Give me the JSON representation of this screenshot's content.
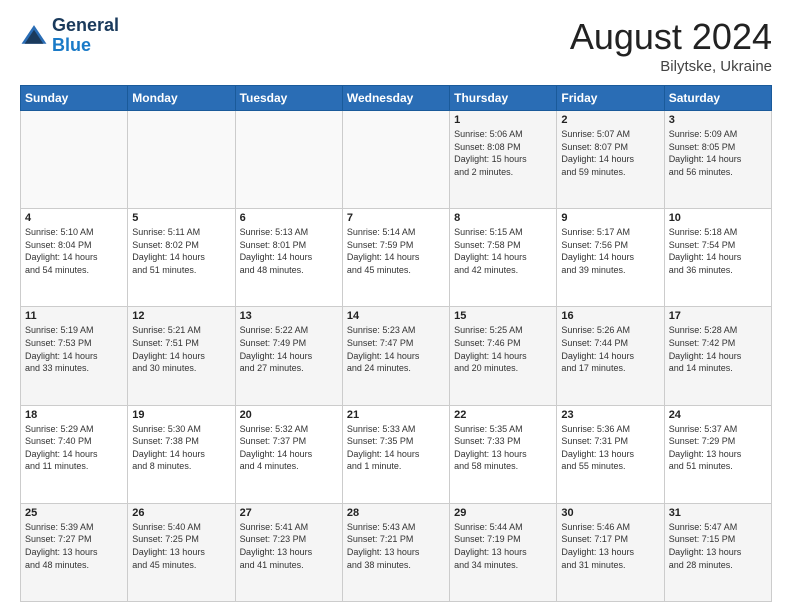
{
  "header": {
    "logo_line1": "General",
    "logo_line2": "Blue",
    "month": "August 2024",
    "location": "Bilytske, Ukraine"
  },
  "weekdays": [
    "Sunday",
    "Monday",
    "Tuesday",
    "Wednesday",
    "Thursday",
    "Friday",
    "Saturday"
  ],
  "weeks": [
    [
      {
        "day": "",
        "info": ""
      },
      {
        "day": "",
        "info": ""
      },
      {
        "day": "",
        "info": ""
      },
      {
        "day": "",
        "info": ""
      },
      {
        "day": "1",
        "info": "Sunrise: 5:06 AM\nSunset: 8:08 PM\nDaylight: 15 hours\nand 2 minutes."
      },
      {
        "day": "2",
        "info": "Sunrise: 5:07 AM\nSunset: 8:07 PM\nDaylight: 14 hours\nand 59 minutes."
      },
      {
        "day": "3",
        "info": "Sunrise: 5:09 AM\nSunset: 8:05 PM\nDaylight: 14 hours\nand 56 minutes."
      }
    ],
    [
      {
        "day": "4",
        "info": "Sunrise: 5:10 AM\nSunset: 8:04 PM\nDaylight: 14 hours\nand 54 minutes."
      },
      {
        "day": "5",
        "info": "Sunrise: 5:11 AM\nSunset: 8:02 PM\nDaylight: 14 hours\nand 51 minutes."
      },
      {
        "day": "6",
        "info": "Sunrise: 5:13 AM\nSunset: 8:01 PM\nDaylight: 14 hours\nand 48 minutes."
      },
      {
        "day": "7",
        "info": "Sunrise: 5:14 AM\nSunset: 7:59 PM\nDaylight: 14 hours\nand 45 minutes."
      },
      {
        "day": "8",
        "info": "Sunrise: 5:15 AM\nSunset: 7:58 PM\nDaylight: 14 hours\nand 42 minutes."
      },
      {
        "day": "9",
        "info": "Sunrise: 5:17 AM\nSunset: 7:56 PM\nDaylight: 14 hours\nand 39 minutes."
      },
      {
        "day": "10",
        "info": "Sunrise: 5:18 AM\nSunset: 7:54 PM\nDaylight: 14 hours\nand 36 minutes."
      }
    ],
    [
      {
        "day": "11",
        "info": "Sunrise: 5:19 AM\nSunset: 7:53 PM\nDaylight: 14 hours\nand 33 minutes."
      },
      {
        "day": "12",
        "info": "Sunrise: 5:21 AM\nSunset: 7:51 PM\nDaylight: 14 hours\nand 30 minutes."
      },
      {
        "day": "13",
        "info": "Sunrise: 5:22 AM\nSunset: 7:49 PM\nDaylight: 14 hours\nand 27 minutes."
      },
      {
        "day": "14",
        "info": "Sunrise: 5:23 AM\nSunset: 7:47 PM\nDaylight: 14 hours\nand 24 minutes."
      },
      {
        "day": "15",
        "info": "Sunrise: 5:25 AM\nSunset: 7:46 PM\nDaylight: 14 hours\nand 20 minutes."
      },
      {
        "day": "16",
        "info": "Sunrise: 5:26 AM\nSunset: 7:44 PM\nDaylight: 14 hours\nand 17 minutes."
      },
      {
        "day": "17",
        "info": "Sunrise: 5:28 AM\nSunset: 7:42 PM\nDaylight: 14 hours\nand 14 minutes."
      }
    ],
    [
      {
        "day": "18",
        "info": "Sunrise: 5:29 AM\nSunset: 7:40 PM\nDaylight: 14 hours\nand 11 minutes."
      },
      {
        "day": "19",
        "info": "Sunrise: 5:30 AM\nSunset: 7:38 PM\nDaylight: 14 hours\nand 8 minutes."
      },
      {
        "day": "20",
        "info": "Sunrise: 5:32 AM\nSunset: 7:37 PM\nDaylight: 14 hours\nand 4 minutes."
      },
      {
        "day": "21",
        "info": "Sunrise: 5:33 AM\nSunset: 7:35 PM\nDaylight: 14 hours\nand 1 minute."
      },
      {
        "day": "22",
        "info": "Sunrise: 5:35 AM\nSunset: 7:33 PM\nDaylight: 13 hours\nand 58 minutes."
      },
      {
        "day": "23",
        "info": "Sunrise: 5:36 AM\nSunset: 7:31 PM\nDaylight: 13 hours\nand 55 minutes."
      },
      {
        "day": "24",
        "info": "Sunrise: 5:37 AM\nSunset: 7:29 PM\nDaylight: 13 hours\nand 51 minutes."
      }
    ],
    [
      {
        "day": "25",
        "info": "Sunrise: 5:39 AM\nSunset: 7:27 PM\nDaylight: 13 hours\nand 48 minutes."
      },
      {
        "day": "26",
        "info": "Sunrise: 5:40 AM\nSunset: 7:25 PM\nDaylight: 13 hours\nand 45 minutes."
      },
      {
        "day": "27",
        "info": "Sunrise: 5:41 AM\nSunset: 7:23 PM\nDaylight: 13 hours\nand 41 minutes."
      },
      {
        "day": "28",
        "info": "Sunrise: 5:43 AM\nSunset: 7:21 PM\nDaylight: 13 hours\nand 38 minutes."
      },
      {
        "day": "29",
        "info": "Sunrise: 5:44 AM\nSunset: 7:19 PM\nDaylight: 13 hours\nand 34 minutes."
      },
      {
        "day": "30",
        "info": "Sunrise: 5:46 AM\nSunset: 7:17 PM\nDaylight: 13 hours\nand 31 minutes."
      },
      {
        "day": "31",
        "info": "Sunrise: 5:47 AM\nSunset: 7:15 PM\nDaylight: 13 hours\nand 28 minutes."
      }
    ]
  ]
}
